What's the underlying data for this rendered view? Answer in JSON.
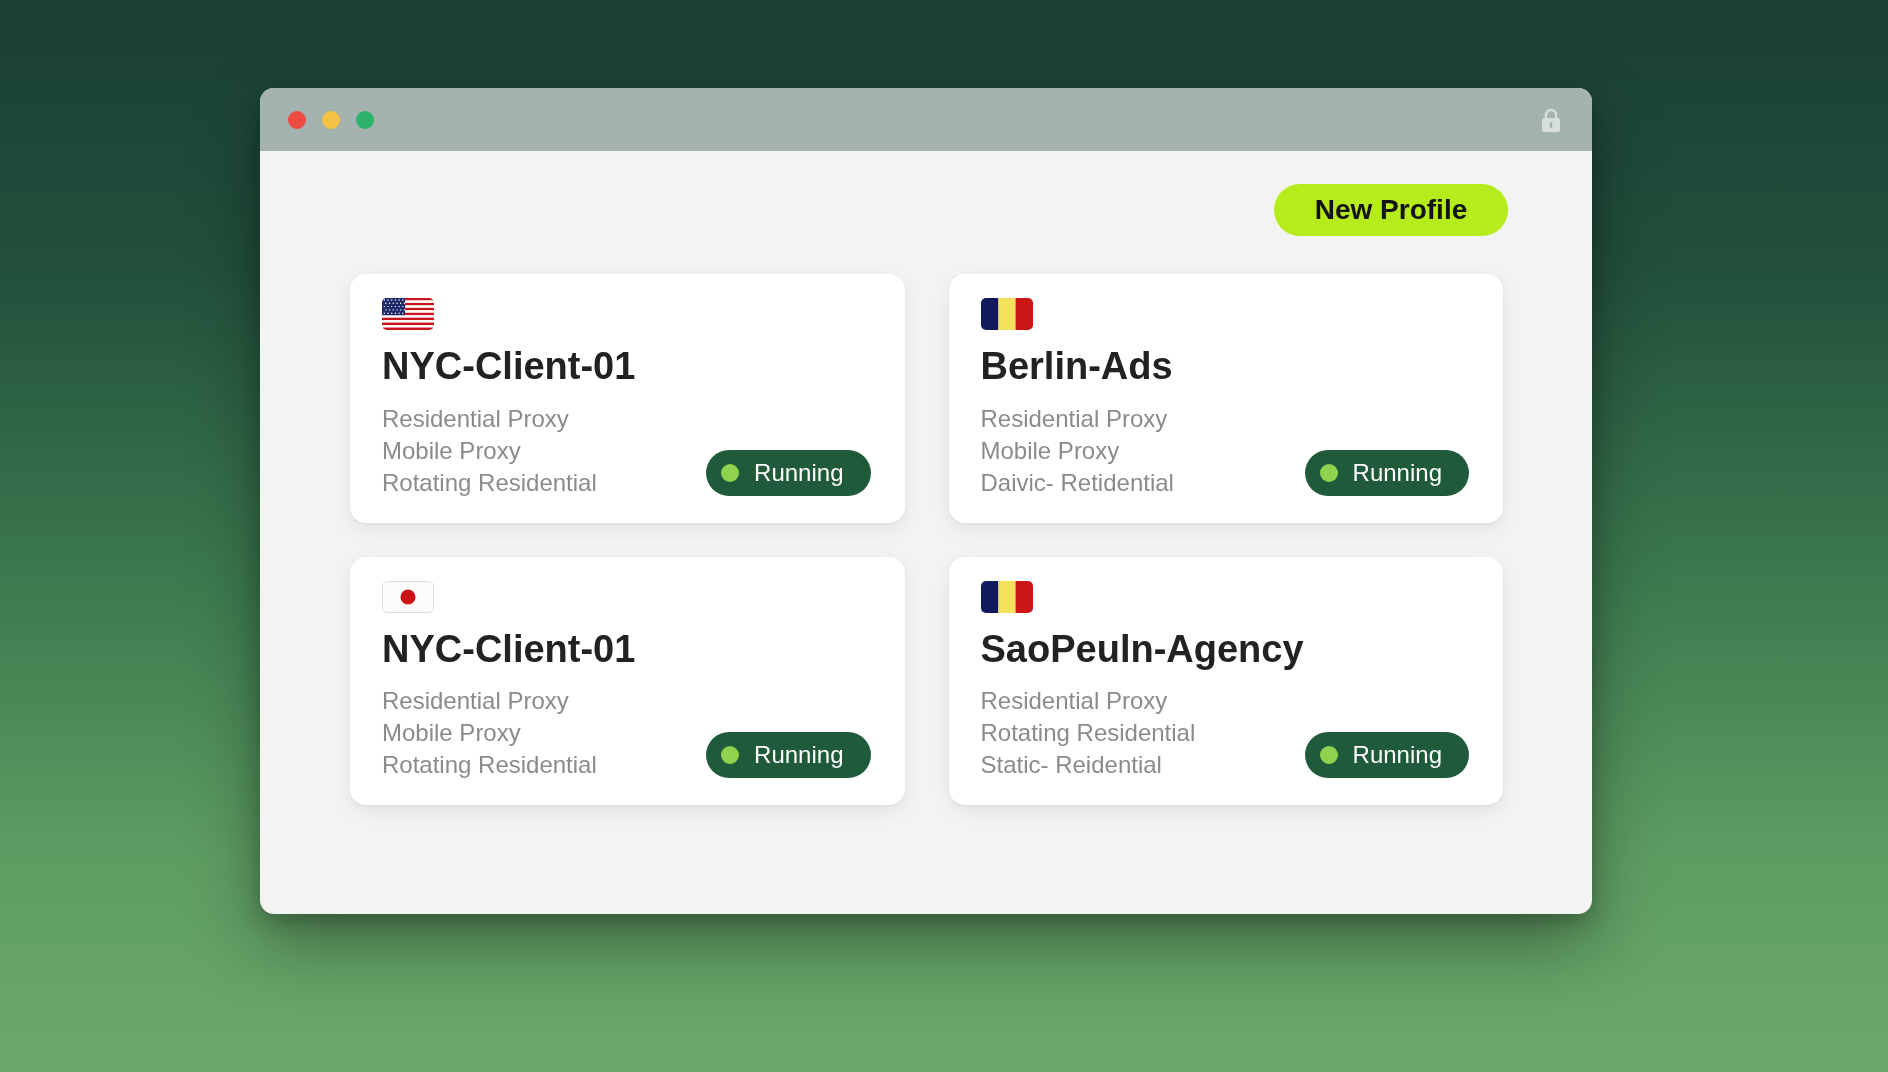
{
  "toolbar": {
    "new_profile_button": "New Profile"
  },
  "profiles": [
    {
      "flag": {
        "kind": "stars-and-stripes"
      },
      "name": "NYC-Client-01",
      "proxy_types": [
        "Residential Proxy",
        "Mobile Proxy",
        "Rotating Residential"
      ],
      "status": "Running"
    },
    {
      "flag": {
        "kind": "tricolor"
      },
      "name": "Berlin-Ads",
      "proxy_types": [
        "Residential Proxy",
        "Mobile Proxy",
        "Daivic- Retidential"
      ],
      "status": "Running"
    },
    {
      "flag": {
        "kind": "disc"
      },
      "name": "NYC-Client-01",
      "proxy_types": [
        "Residential Proxy",
        "Mobile Proxy",
        "Rotating Residential"
      ],
      "status": "Running"
    },
    {
      "flag": {
        "kind": "tricolor"
      },
      "name": "SaoPeuln-Agency",
      "proxy_types": [
        "Residential Proxy",
        "Rotating Residential",
        "Static- Reidential"
      ],
      "status": "Running"
    }
  ]
}
